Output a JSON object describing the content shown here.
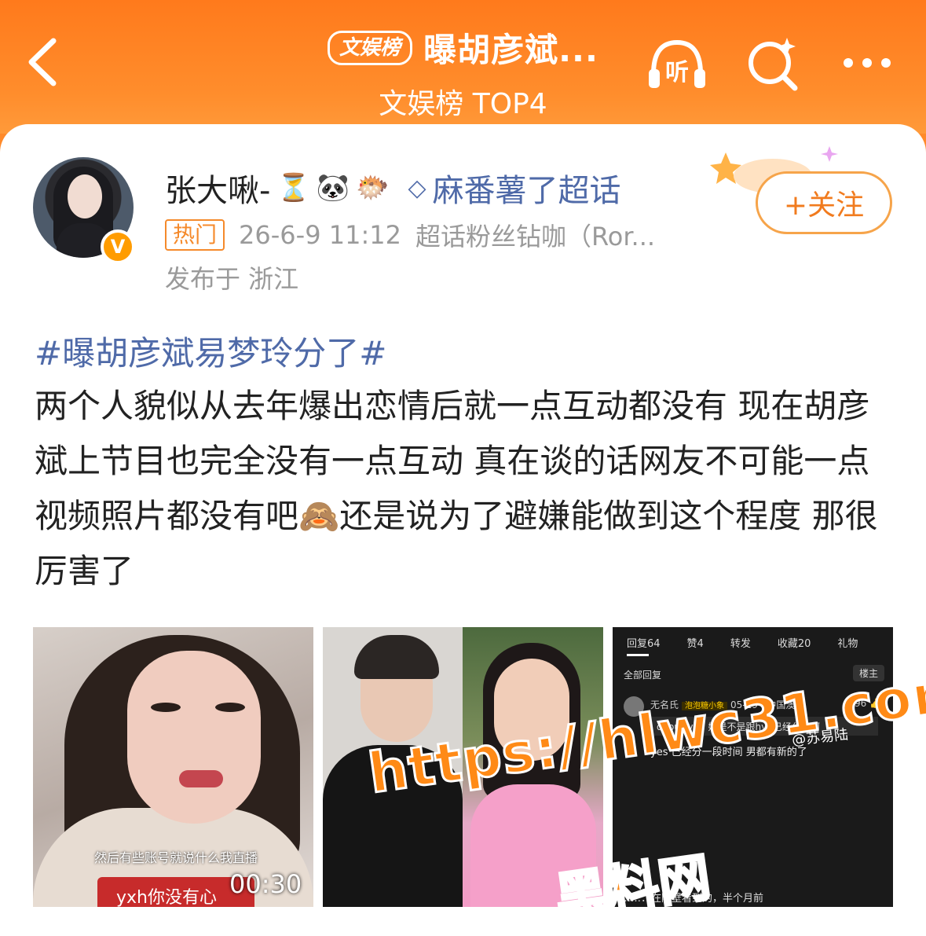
{
  "header": {
    "back_icon": "chevron-left-icon",
    "rank_badge": "文娱榜",
    "title": "曝胡彦斌...",
    "subtitle": "文娱榜 TOP4",
    "listen_label": "听",
    "search_icon": "search-sparkle-icon",
    "more_icon": "more-dots-icon"
  },
  "post": {
    "username": "张大啾-",
    "emojis": [
      "⏳",
      "🐼",
      "🐡"
    ],
    "chaohua": "麻番薯了超话",
    "hot_tag": "热门",
    "time": "26-6-9 11:12",
    "source": "超话粉丝钻咖（Ror...",
    "location": "发布于 浙江",
    "follow_label": "+关注",
    "hashtag": "#曝胡彦斌易梦玲分了#",
    "text": "两个人貌似从去年爆出恋情后就一点互动都没有 现在胡彦斌上节目也完全没有一点互动 真在谈的话网友不可能一点视频照片都没有吧🙈还是说为了避嫌能做到这个程度 那很厉害了"
  },
  "images": {
    "img1_caption": "然后有些账号就说什么我直播",
    "img1_red": "yxh你没有心",
    "img1_time": "00:30",
    "img3_tabs": [
      "回复64",
      "赞4",
      "转发",
      "收藏20",
      "礼物"
    ],
    "img3_all": "全部回复",
    "img3_lz": "楼主",
    "img3_user": "无名氏",
    "img3_tag": "泡泡糖小象",
    "img3_date": "05-19 · 中国澳门",
    "img3_like": "96",
    "img3_quote": "doouttvy：她是不是跟hyb已经分了啊",
    "img3_reply": "yes 已经分一段时间 男都有新的了",
    "img3_wm": "@苏易陆",
    "img3_bottom": "……：在隔壁看到的，半个月前"
  },
  "watermark": {
    "line1": "https://hlwc31.com",
    "line2": "黑料网"
  },
  "colors": {
    "header_orange": "#ff7a1c",
    "link_blue": "#4f6aa8",
    "follow_orange": "#f17b1e"
  }
}
